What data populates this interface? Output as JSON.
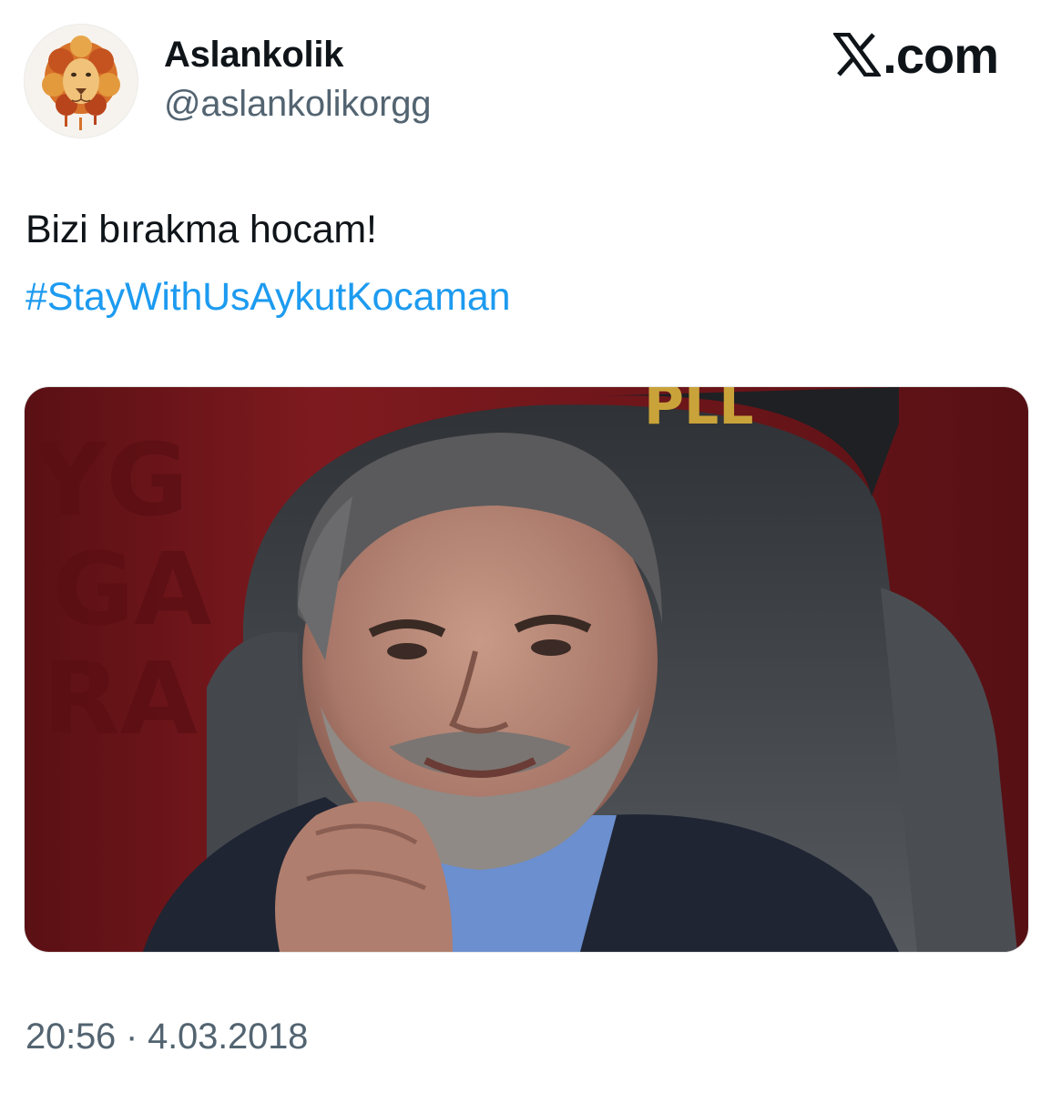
{
  "author": {
    "display_name": "Aslankolik",
    "handle": "@aslankolikorgg",
    "avatar_icon": "lion-head-icon"
  },
  "brand": {
    "logo_icon": "x-logo-icon",
    "text": ".com"
  },
  "tweet": {
    "text": "Bizi bırakma hocam!",
    "hashtag": "#StayWithUsAykutKocaman",
    "image_alt": "photo"
  },
  "meta": {
    "time": "20:56",
    "separator": "·",
    "date": "4.03.2018"
  },
  "colors": {
    "text_primary": "#0f1419",
    "text_secondary": "#536471",
    "link": "#1d9bf0",
    "stadium_red": "#7a1a1e",
    "seat_gray": "#6b6f73"
  }
}
